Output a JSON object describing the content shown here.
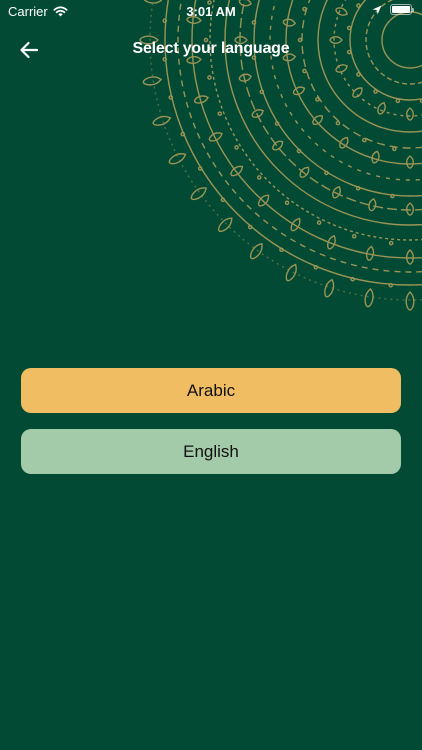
{
  "status_bar": {
    "carrier": "Carrier",
    "time": "3:01 AM"
  },
  "header": {
    "title": "Select your language"
  },
  "languages": [
    {
      "label": "Arabic",
      "color": "#f1bd62"
    },
    {
      "label": "English",
      "color": "#a3cba9"
    }
  ],
  "colors": {
    "background": "#034a35",
    "ornament": "#b5a15a"
  },
  "icons": {
    "back": "arrow-left-icon",
    "wifi": "wifi-icon",
    "location": "location-arrow-icon",
    "battery": "battery-icon",
    "ornament": "mandala-ornament"
  }
}
